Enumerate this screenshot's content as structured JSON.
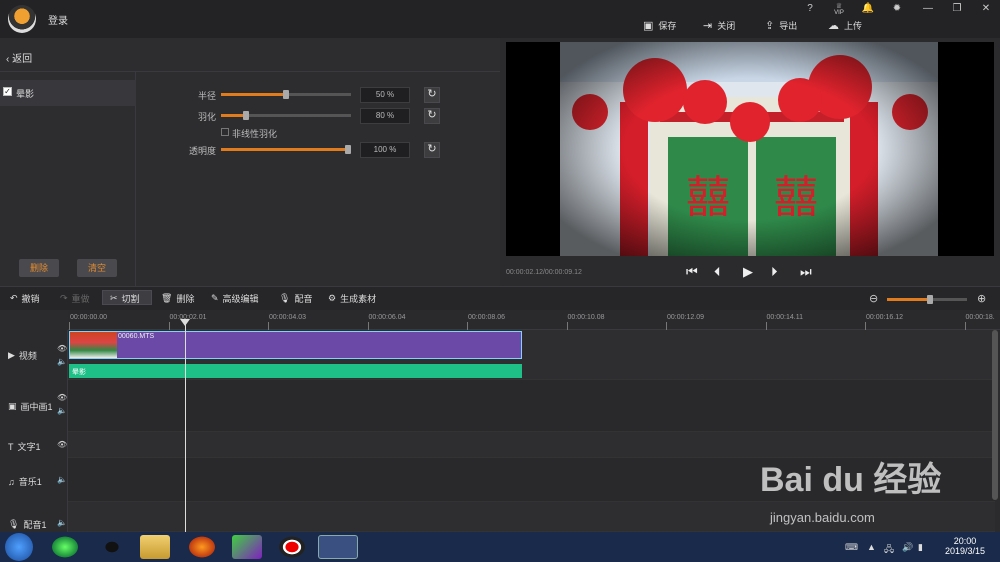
{
  "titlebar": {
    "login": "登录",
    "icons": [
      "help-icon",
      "vip-icon",
      "bell-icon",
      "settings-icon",
      "minimize-icon",
      "restore-icon",
      "close-icon"
    ],
    "help": "?",
    "vip": "VIP",
    "save": "保存",
    "close": "关闭",
    "export": "导出",
    "upload": "上传"
  },
  "panel": {
    "back": "返回",
    "effect": "晕影",
    "delete": "删除",
    "clear": "清空",
    "params": [
      {
        "label": "半径",
        "value": "50 %",
        "level": 0.5
      },
      {
        "label": "羽化",
        "value": "80 %",
        "level": 0.18
      },
      {
        "label": "透明度",
        "value": "100 %",
        "level": 1.0
      }
    ],
    "nonlinear": "非线性羽化"
  },
  "preview": {
    "timecode": "00:00:02.12/00:00:09.12",
    "door_text": "囍"
  },
  "toolbar": {
    "undo": "撤销",
    "redo": "重做",
    "cut": "切割",
    "delete": "删除",
    "advanced": "高级编辑",
    "dub": "配音",
    "generate": "生成素材",
    "zoom_level": 0.55
  },
  "ruler": [
    "00:00:00.00",
    "00:00:02.01",
    "00:00:04.03",
    "00:00:06.04",
    "00:00:08.06",
    "00:00:10.08",
    "00:00:12.09",
    "00:00:14.11",
    "00:00:16.12",
    "00:00:18."
  ],
  "tracks": {
    "video": "视频",
    "pip": "画中画1",
    "text": "文字1",
    "music": "音乐1",
    "voice": "配音1"
  },
  "clip": {
    "name": "00060.MTS",
    "effect_label": "晕影"
  },
  "taskbar": {
    "time": "20:00",
    "date": "2019/3/15"
  },
  "watermark": {
    "logo": "Bai du 经验",
    "url": "jingyan.baidu.com"
  }
}
